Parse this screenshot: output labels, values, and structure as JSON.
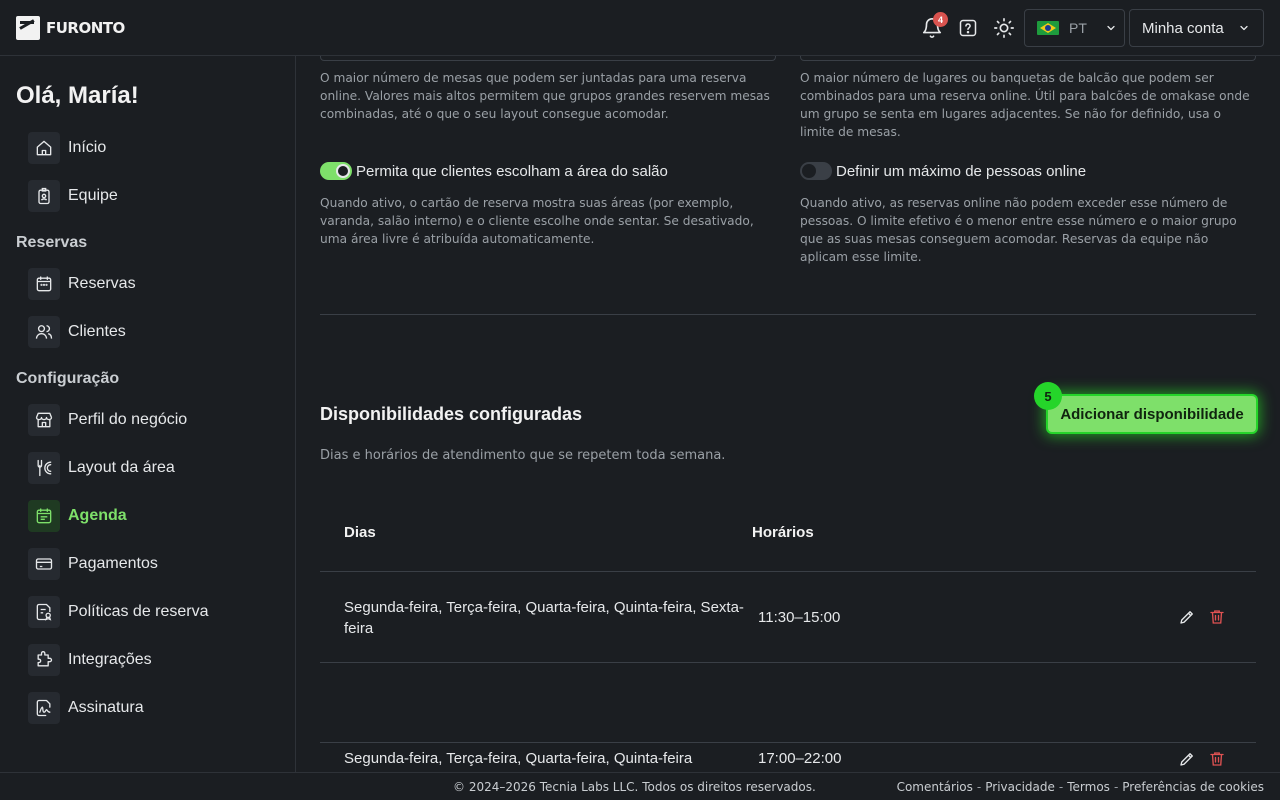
{
  "header": {
    "logo_text": "FURONTO",
    "notification_count": "4",
    "language": "PT",
    "account_label": "Minha conta"
  },
  "sidebar": {
    "greeting": "Olá, María!",
    "items": [
      {
        "label": "Início",
        "icon": "home-icon"
      },
      {
        "label": "Equipe",
        "icon": "badge-icon"
      }
    ],
    "sections": [
      {
        "title": "Reservas",
        "items": [
          {
            "label": "Reservas",
            "icon": "calendar-icon"
          },
          {
            "label": "Clientes",
            "icon": "users-icon"
          }
        ]
      },
      {
        "title": "Configuração",
        "items": [
          {
            "label": "Perfil do negócio",
            "icon": "store-icon"
          },
          {
            "label": "Layout da área",
            "icon": "utensils-icon"
          },
          {
            "label": "Agenda",
            "icon": "calendar-list-icon",
            "active": true
          },
          {
            "label": "Pagamentos",
            "icon": "card-icon"
          },
          {
            "label": "Políticas de reserva",
            "icon": "policy-icon"
          },
          {
            "label": "Integrações",
            "icon": "puzzle-icon"
          },
          {
            "label": "Assinatura",
            "icon": "signature-icon"
          }
        ]
      }
    ]
  },
  "main": {
    "help_max_tables": "O maior número de mesas que podem ser juntadas para uma reserva online. Valores mais altos permitem que grupos grandes reservem mesas combinadas, até o que o seu layout consegue acomodar.",
    "help_max_seats": "O maior número de lugares ou banquetas de balcão que podem ser combinados para uma reserva online. Útil para balcões de omakase onde um grupo se senta em lugares adjacentes. Se não for definido, usa o limite de mesas.",
    "toggle_area": {
      "label": "Permita que clientes escolham a área do salão",
      "on": true
    },
    "help_area": "Quando ativo, o cartão de reserva mostra suas áreas (por exemplo, varanda, salão interno) e o cliente escolhe onde sentar. Se desativado, uma área livre é atribuída automaticamente.",
    "toggle_max_people": {
      "label": "Definir um máximo de pessoas online",
      "on": false
    },
    "help_max_people": "Quando ativo, as reservas online não podem exceder esse número de pessoas. O limite efetivo é o menor entre esse número e o maior grupo que as suas mesas conseguem acomodar. Reservas da equipe não aplicam esse limite.",
    "section_title": "Disponibilidades configuradas",
    "section_desc": "Dias e horários de atendimento que se repetem toda semana.",
    "add_button": "Adicionar disponibilidade",
    "step_badge": "5",
    "table": {
      "headers": {
        "days": "Dias",
        "hours": "Horários"
      },
      "rows": [
        {
          "days": "Segunda-feira, Terça-feira, Quarta-feira, Quinta-feira, Sexta-feira",
          "hours": "11:30–15:00"
        },
        {
          "days": "Segunda-feira, Terça-feira, Quarta-feira, Quinta-feira",
          "hours": "17:00–22:00"
        }
      ]
    }
  },
  "footer": {
    "copyright": "© 2024–2026 Tecnia Labs LLC. Todos os direitos reservados.",
    "links": [
      "Comentários",
      "Privacidade",
      "Termos",
      "Preferências de cookies"
    ],
    "separator": "-"
  },
  "colors": {
    "background": "#1b1e22",
    "accent": "#7ee06a",
    "highlight": "#25d52a",
    "danger": "#d9534f"
  }
}
